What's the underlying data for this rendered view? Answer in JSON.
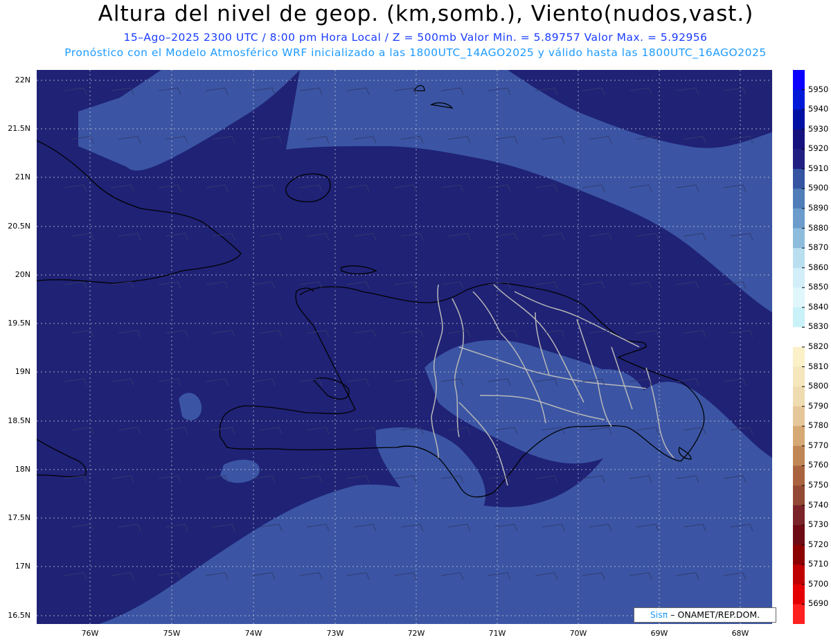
{
  "header": {
    "title": "Altura del nivel de geop. (km,somb.), Viento(nudos,vast.)",
    "line1": "15–Ago–2025  2300 UTC / 8:00 pm Hora Local / Z = 500mb     Valor Min. = 5.89757  Valor Max. = 5.92956",
    "line2": "Pronóstico con el Modelo Atmosférico WRF inicializado a las 1800UTC_14AGO2025 y válido hasta las  1800UTC_16AGO2025"
  },
  "map": {
    "lat_labels": [
      "22N",
      "21.5N",
      "21N",
      "20.5N",
      "20N",
      "19.5N",
      "19N",
      "18.5N",
      "18N",
      "17.5N",
      "17N",
      "16.5N"
    ],
    "lon_labels": [
      "76W",
      "75W",
      "74W",
      "73W",
      "72W",
      "71W",
      "70W",
      "69W",
      "68W"
    ],
    "background_color": "#1f2275",
    "lighter_shade_color": "#3b55a4",
    "coast_color": "#000000",
    "border_color": "#b8b8b8"
  },
  "colorbar": {
    "levels": [
      "5950",
      "5940",
      "5930",
      "5920",
      "5910",
      "5900",
      "5890",
      "5880",
      "5870",
      "5860",
      "5850",
      "5840",
      "5830",
      "5820",
      "5810",
      "5800",
      "5790",
      "5780",
      "5770",
      "5760",
      "5750",
      "5740",
      "5730",
      "5720",
      "5710",
      "5700",
      "5690"
    ],
    "colors": [
      "#0b00ff",
      "#0019d9",
      "#0010a3",
      "#15127d",
      "#221f83",
      "#3555a3",
      "#4f7db8",
      "#6b9ccb",
      "#8ebcdc",
      "#b8def0",
      "#d2eef8",
      "#dff6fb",
      "#c9f2f8",
      "#ffffff",
      "#fbf0c8",
      "#f5e6bb",
      "#efdbb0",
      "#e6c79a",
      "#d5a874",
      "#c08656",
      "#a9643f",
      "#934a34",
      "#7a2329",
      "#6e0a14",
      "#8c0000",
      "#c00000",
      "#e40000",
      "#ff2020"
    ]
  },
  "credit": {
    "name": "Sisπ",
    "org": "– ONAMET/REP.DOM."
  }
}
